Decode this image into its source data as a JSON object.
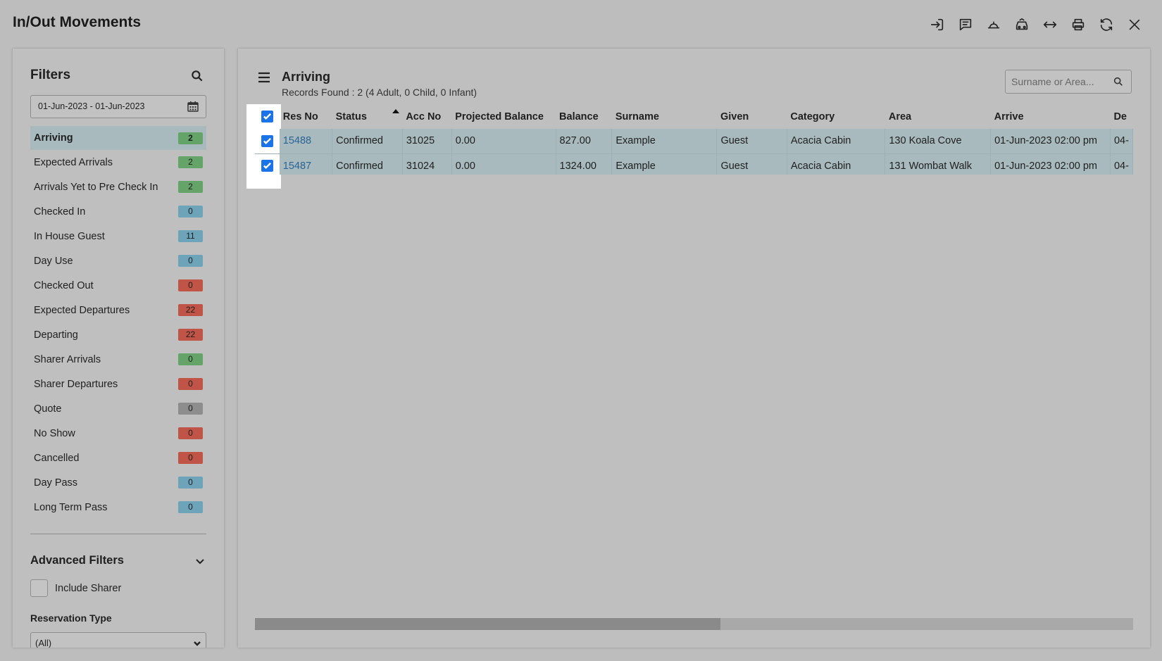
{
  "app": {
    "title": "In/Out Movements"
  },
  "toolbar": {
    "icons": [
      "login-icon",
      "message-icon",
      "bell-service-icon",
      "car-icon",
      "resize-horizontal-icon",
      "print-icon",
      "refresh-icon",
      "close-icon"
    ]
  },
  "sidebar": {
    "title": "Filters",
    "date_range": "01-Jun-2023 - 01-Jun-2023",
    "items": [
      {
        "label": "Arriving",
        "count": "2",
        "color": "green",
        "active": true
      },
      {
        "label": "Expected Arrivals",
        "count": "2",
        "color": "green"
      },
      {
        "label": "Arrivals Yet to Pre Check In",
        "count": "2",
        "color": "green"
      },
      {
        "label": "Checked In",
        "count": "0",
        "color": "blue"
      },
      {
        "label": "In House Guest",
        "count": "11",
        "color": "blue"
      },
      {
        "label": "Day Use",
        "count": "0",
        "color": "blue"
      },
      {
        "label": "Checked Out",
        "count": "0",
        "color": "red"
      },
      {
        "label": "Expected Departures",
        "count": "22",
        "color": "red"
      },
      {
        "label": "Departing",
        "count": "22",
        "color": "red"
      },
      {
        "label": "Sharer Arrivals",
        "count": "0",
        "color": "green"
      },
      {
        "label": "Sharer Departures",
        "count": "0",
        "color": "red"
      },
      {
        "label": "Quote",
        "count": "0",
        "color": "grey"
      },
      {
        "label": "No Show",
        "count": "0",
        "color": "red"
      },
      {
        "label": "Cancelled",
        "count": "0",
        "color": "red"
      },
      {
        "label": "Day Pass",
        "count": "0",
        "color": "blue"
      },
      {
        "label": "Long Term Pass",
        "count": "0",
        "color": "blue"
      }
    ],
    "advanced_filters": "Advanced Filters",
    "include_sharer": "Include Sharer",
    "reservation_type_label": "Reservation Type",
    "reservation_type_value": "(All)"
  },
  "main": {
    "title": "Arriving",
    "records_found": "Records Found : 2 (4 Adult, 0 Child, 0 Infant)",
    "search_placeholder": "Surname or Area...",
    "columns": [
      "Res No",
      "Status",
      "Acc No",
      "Projected Balance",
      "Balance",
      "Surname",
      "Given",
      "Category",
      "Area",
      "Arrive",
      "De"
    ],
    "rows": [
      {
        "res_no": "15488",
        "status": "Confirmed",
        "acc_no": "31025",
        "projected_balance": "0.00",
        "balance": "827.00",
        "surname": "Example",
        "given": "Guest",
        "category": "Acacia Cabin",
        "area": "130 Koala Cove",
        "arrive": "01-Jun-2023 02:00 pm",
        "depart": "04-"
      },
      {
        "res_no": "15487",
        "status": "Confirmed",
        "acc_no": "31024",
        "projected_balance": "0.00",
        "balance": "1324.00",
        "surname": "Example",
        "given": "Guest",
        "category": "Acacia Cabin",
        "area": "131 Wombat Walk",
        "arrive": "01-Jun-2023 02:00 pm",
        "depart": "04-"
      }
    ],
    "scroll_fraction": 0.53
  },
  "colors": {
    "active_filter_bg": "#a8babe",
    "badge_green": "#65a468",
    "badge_blue": "#6ea4b9",
    "badge_red": "#c05547",
    "badge_grey": "#8d8d8d",
    "checkbox": "#1a73e8",
    "link": "#2a6496"
  }
}
